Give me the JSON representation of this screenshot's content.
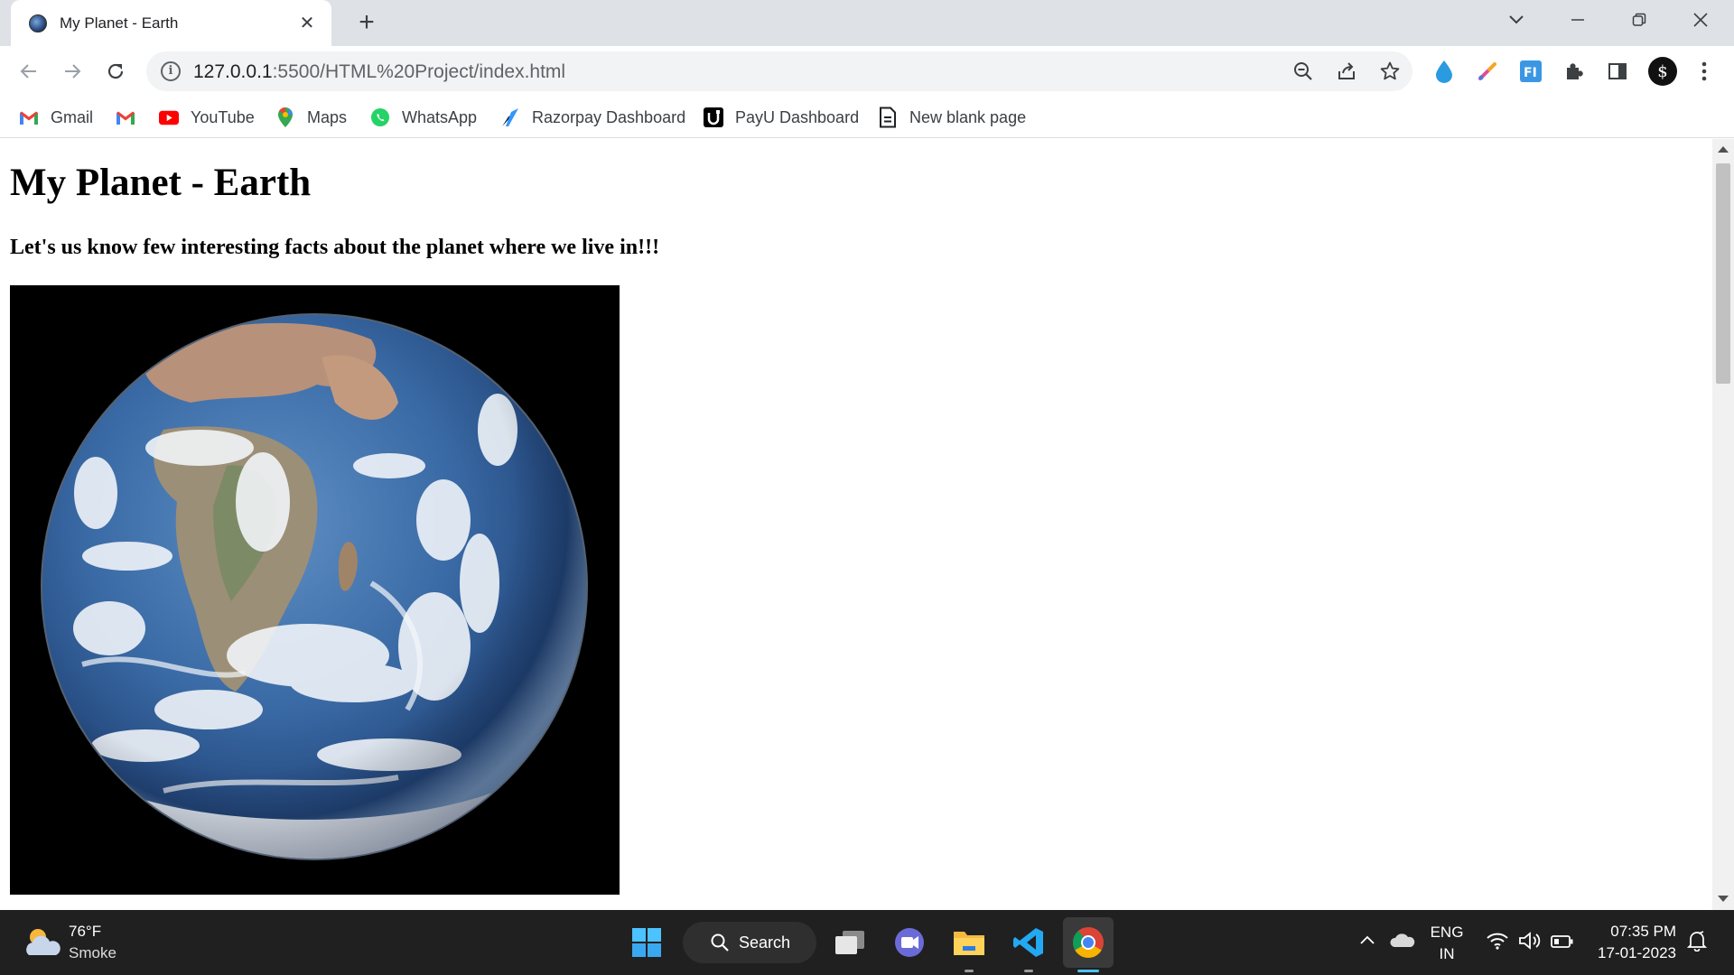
{
  "browser": {
    "tab": {
      "title": "My Planet - Earth",
      "close_glyph": "✕",
      "favicon": "earth-icon"
    },
    "new_tab_glyph": "+",
    "window_controls": [
      "chevron-down-icon",
      "minimize-icon",
      "restore-icon",
      "close-icon"
    ],
    "address": {
      "host": "127.0.0.1",
      "rest": ":5500/HTML%20Project/index.html"
    },
    "profile_initial": "$"
  },
  "bookmarks": [
    {
      "label": "Gmail",
      "icon": "gmail-icon"
    },
    {
      "label": "",
      "icon": "gmail-icon"
    },
    {
      "label": "YouTube",
      "icon": "youtube-icon"
    },
    {
      "label": "Maps",
      "icon": "maps-icon"
    },
    {
      "label": "WhatsApp",
      "icon": "whatsapp-icon"
    },
    {
      "label": "Razorpay Dashboard",
      "icon": "razorpay-icon"
    },
    {
      "label": "PayU Dashboard",
      "icon": "payu-icon"
    },
    {
      "label": "New blank page",
      "icon": "document-icon"
    }
  ],
  "page": {
    "heading": "My Planet - Earth",
    "subheading": "Let's us know few interesting facts about the planet where we live in!!!"
  },
  "taskbar": {
    "weather": {
      "temp": "76°F",
      "desc": "Smoke"
    },
    "search_label": "Search",
    "language": {
      "line1": "ENG",
      "line2": "IN"
    },
    "clock": {
      "time": "07:35 PM",
      "date": "17-01-2023"
    }
  },
  "colors": {
    "tab_strip": "#dee1e6",
    "taskbar": "#202020",
    "accent": "#1a73e8"
  }
}
